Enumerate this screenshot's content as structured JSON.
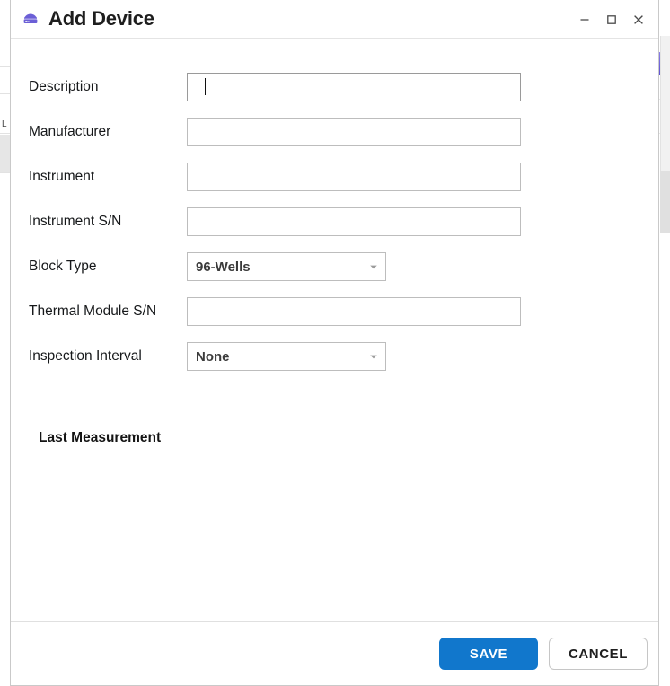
{
  "background": {
    "right_glyph": "█",
    "scrollbar_name": "parent-window-scrollbar"
  },
  "titlebar": {
    "icon": "device-icon",
    "title": "Add Device",
    "controls": [
      {
        "name": "minimize-button",
        "glyph": "─"
      },
      {
        "name": "maximize-button",
        "glyph": "□"
      },
      {
        "name": "close-button",
        "glyph": "✕"
      }
    ]
  },
  "form": {
    "fields": [
      {
        "label": "Description",
        "type": "text",
        "value": "",
        "placeholder": "",
        "focused": true
      },
      {
        "label": "Manufacturer",
        "type": "text",
        "value": "",
        "placeholder": "",
        "focused": false
      },
      {
        "label": "Instrument",
        "type": "text",
        "value": "",
        "placeholder": "",
        "focused": false
      },
      {
        "label": "Instrument S/N",
        "type": "text",
        "value": "",
        "placeholder": "",
        "focused": false
      },
      {
        "label": "Block Type",
        "type": "select",
        "value": "96-Wells"
      },
      {
        "label": "Thermal Module S/N",
        "type": "text",
        "value": "",
        "placeholder": "",
        "focused": false
      },
      {
        "label": "Inspection Interval",
        "type": "select",
        "value": "None"
      }
    ],
    "section_title": "Last Measurement"
  },
  "footer": {
    "save_label": "SAVE",
    "cancel_label": "CANCEL"
  },
  "colors": {
    "accent_blue": "#1177cc",
    "icon_purple": "#6b5fd6",
    "label_text": "#16181a",
    "border_gray": "#bdbdbd"
  }
}
